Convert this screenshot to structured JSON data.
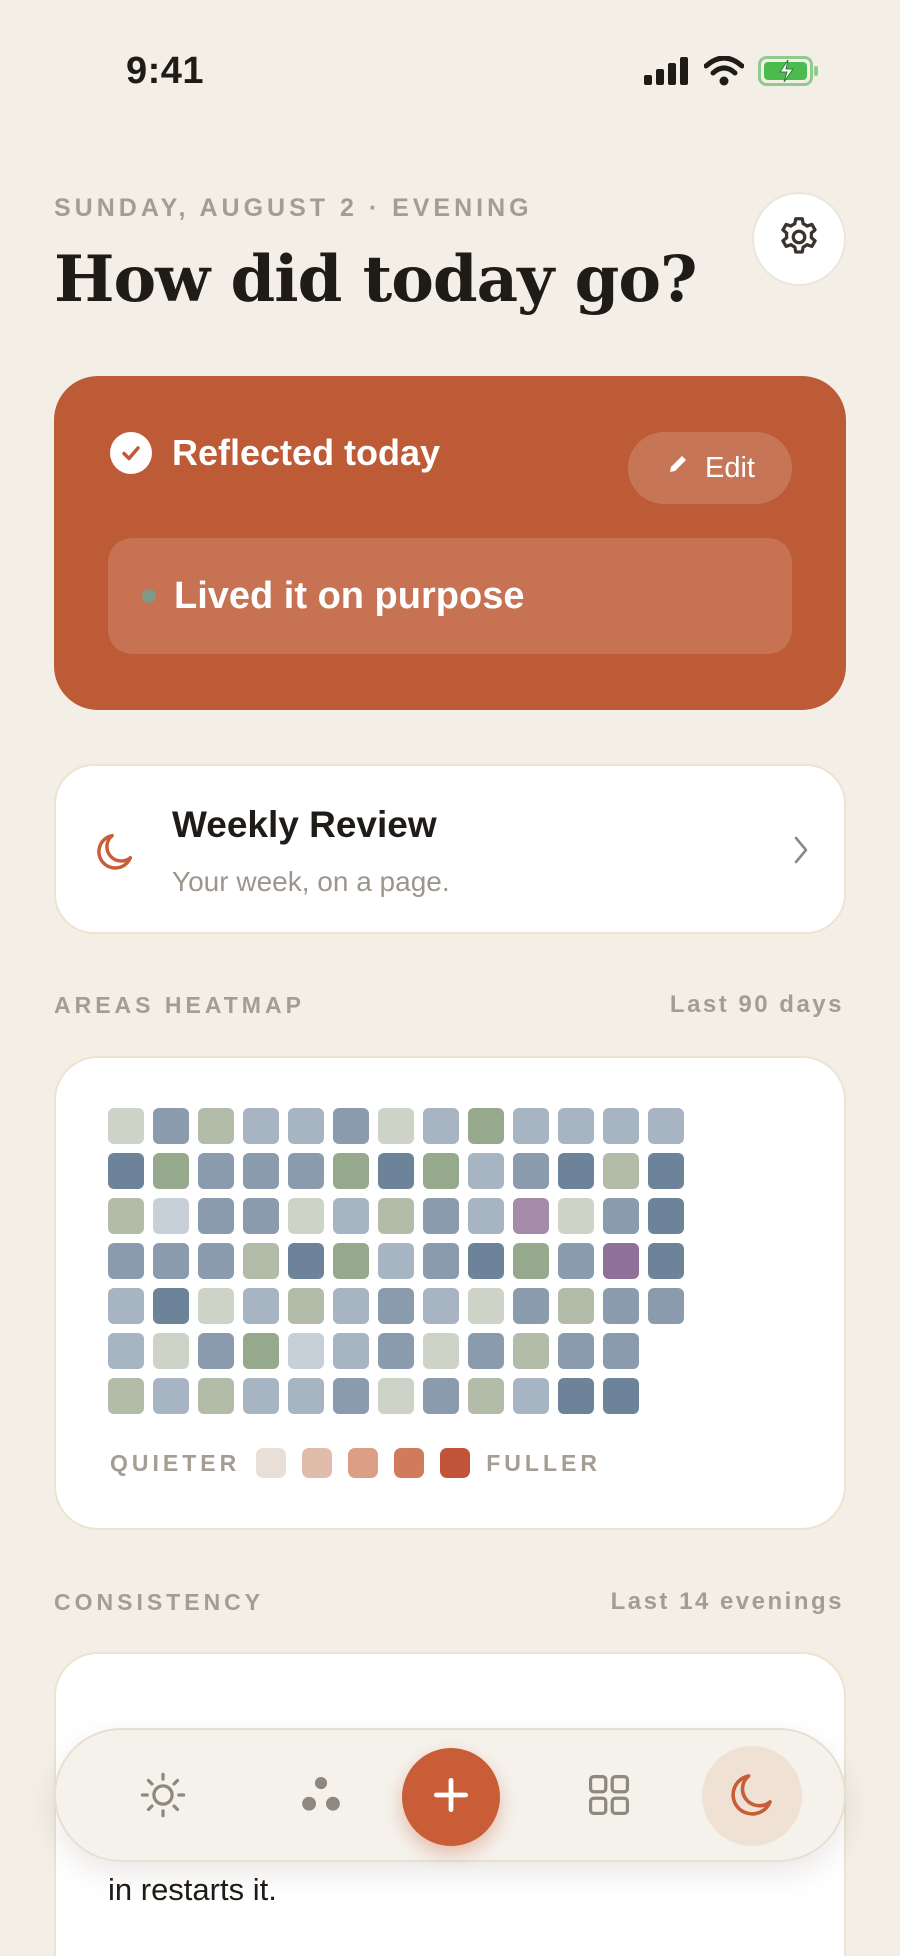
{
  "status_bar": {
    "time": "9:41"
  },
  "header": {
    "date_line": "SUNDAY, AUGUST 2 · EVENING",
    "title": "How did today go?"
  },
  "reflection": {
    "status_label": "Reflected today",
    "edit_label": "Edit",
    "intention_text": "Lived it on purpose"
  },
  "weekly_review": {
    "title": "Weekly Review",
    "subtitle": "Your week, on a page."
  },
  "heatmap": {
    "section_label": "AREAS HEATMAP",
    "range_label": "Last 90 days",
    "legend_low": "QUIETER",
    "legend_high": "FULLER",
    "legend_colors": [
      "#EADFD6",
      "#E2BCAA",
      "#DC9F85",
      "#D17B5D",
      "#C1553A"
    ],
    "cell_colors": [
      [
        "#CDD3C6",
        "#8A9BAD",
        "#B2BCA8",
        "#A7B4C1",
        "#A7B4C1",
        "#8A9BAD",
        "#CDD3C6",
        "#A7B4C1",
        "#97A98D",
        "#A7B4C1",
        "#A7B4C1",
        "#A7B4C1",
        "#A7B4C1"
      ],
      [
        "#6C8399",
        "#97A98D",
        "#8A9BAD",
        "#8A9BAD",
        "#8A9BAD",
        "#97A98D",
        "#6C8399",
        "#97A98D",
        "#A7B4C1",
        "#8A9BAD",
        "#6C8399",
        "#B2BCA8",
        "#6C8399"
      ],
      [
        "#B2BCA8",
        "#C7CFD9",
        "#8A9BAD",
        "#8A9BAD",
        "#CDD3C6",
        "#A7B4C1",
        "#B2BCA8",
        "#8A9BAD",
        "#A7B4C1",
        "#A48BA8",
        "#CDD3C6",
        "#8A9BAD",
        "#6C8399"
      ],
      [
        "#8A9BAD",
        "#8A9BAD",
        "#8A9BAD",
        "#B2BCA8",
        "#6C8399",
        "#97A98D",
        "#A7B4C1",
        "#8A9BAD",
        "#6C8399",
        "#97A98D",
        "#8A9BAD",
        "#8F7099",
        "#6C8399"
      ],
      [
        "#A7B4C1",
        "#6C8399",
        "#CDD3C6",
        "#A7B4C1",
        "#B2BCA8",
        "#A7B4C1",
        "#8A9BAD",
        "#A7B4C1",
        "#CDD3C6",
        "#8A9BAD",
        "#B2BCA8",
        "#8A9BAD",
        "#8A9BAD"
      ],
      [
        "#A7B4C1",
        "#CDD3C6",
        "#8A9BAD",
        "#97A98D",
        "#C7CFD9",
        "#A7B4C1",
        "#8A9BAD",
        "#CDD3C6",
        "#8A9BAD",
        "#B2BCA8",
        "#8A9BAD",
        "#8A9BAD"
      ],
      [
        "#B2BCA8",
        "#A7B4C1",
        "#B2BCA8",
        "#A7B4C1",
        "#A7B4C1",
        "#8A9BAD",
        "#CDD3C6",
        "#8A9BAD",
        "#B2BCA8",
        "#A7B4C1",
        "#6C8399",
        "#6C8399"
      ]
    ]
  },
  "consistency": {
    "section_label": "CONSISTENCY",
    "range_label": "Last 14 evenings",
    "visible_text": "in restarts it."
  },
  "tab_bar": {
    "tabs": [
      {
        "icon": "sun-icon"
      },
      {
        "icon": "areas-dots-icon"
      },
      {
        "icon": "plus-icon"
      },
      {
        "icon": "grid-icon"
      },
      {
        "icon": "moon-icon",
        "selected": true
      }
    ]
  },
  "colors": {
    "background": "#F3EFE6",
    "accent": "#C85D37",
    "card": "#FFFFFF",
    "muted_text": "#A39D93"
  }
}
